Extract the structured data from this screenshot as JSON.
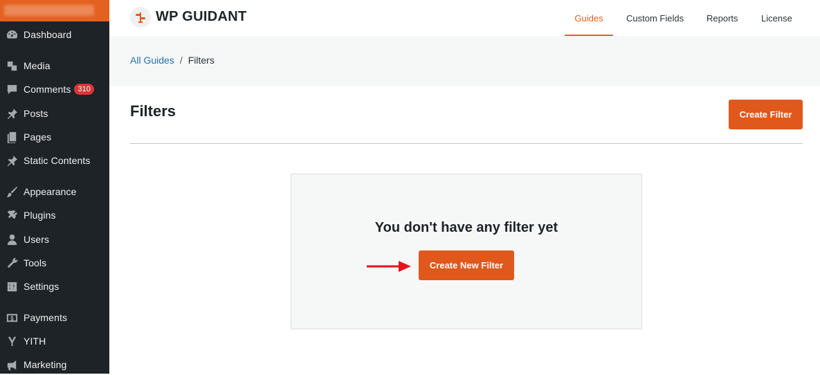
{
  "sidebar": {
    "items": [
      {
        "label": "Dashboard",
        "icon": "dashboard-icon"
      },
      {
        "label": "Media",
        "icon": "media-icon"
      },
      {
        "label": "Comments",
        "icon": "comments-icon",
        "badge": "310"
      },
      {
        "label": "Posts",
        "icon": "pin-icon"
      },
      {
        "label": "Pages",
        "icon": "pages-icon"
      },
      {
        "label": "Static Contents",
        "icon": "pin-icon"
      },
      {
        "label": "Appearance",
        "icon": "brush-icon"
      },
      {
        "label": "Plugins",
        "icon": "plugin-icon"
      },
      {
        "label": "Users",
        "icon": "users-icon"
      },
      {
        "label": "Tools",
        "icon": "wrench-icon"
      },
      {
        "label": "Settings",
        "icon": "settings-icon"
      },
      {
        "label": "Payments",
        "icon": "payments-icon"
      },
      {
        "label": "YITH",
        "icon": "yith-icon"
      },
      {
        "label": "Marketing",
        "icon": "megaphone-icon"
      }
    ]
  },
  "header": {
    "logo_text": "WP GUIDANT",
    "tabs": [
      {
        "label": "Guides",
        "active": true
      },
      {
        "label": "Custom Fields",
        "active": false
      },
      {
        "label": "Reports",
        "active": false
      },
      {
        "label": "License",
        "active": false
      }
    ]
  },
  "breadcrumb": {
    "link": "All Guides",
    "separator": "/",
    "current": "Filters"
  },
  "main": {
    "title": "Filters",
    "create_button": "Create Filter",
    "empty_message": "You don't have any filter yet",
    "create_new_button": "Create New Filter"
  },
  "colors": {
    "accent": "#e0581c",
    "sidebar_bg": "#1d2327",
    "link": "#2271b1",
    "badge": "#d63638",
    "arrow": "#e8121c"
  }
}
